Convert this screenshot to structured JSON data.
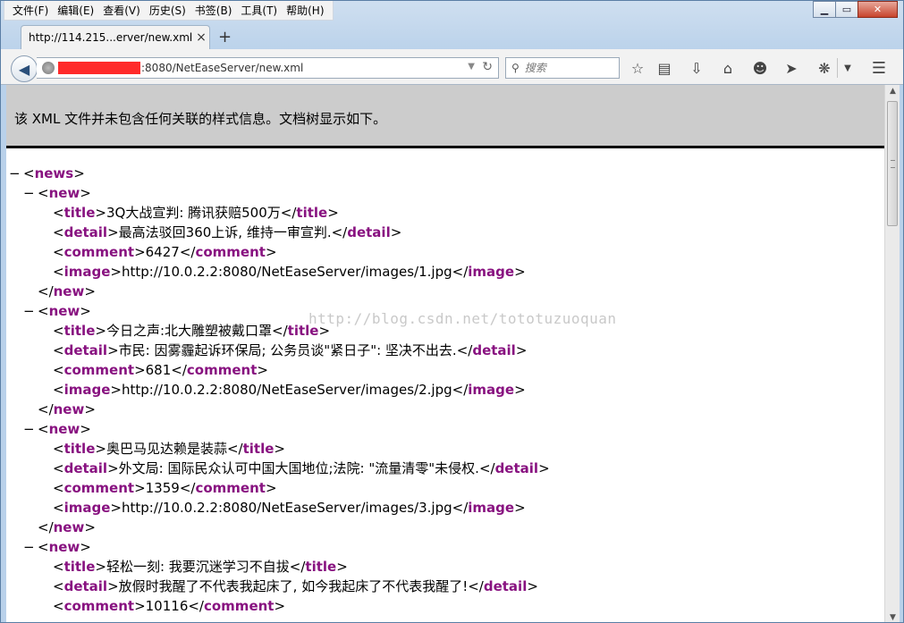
{
  "menu": [
    "文件(F)",
    "编辑(E)",
    "查看(V)",
    "历史(S)",
    "书签(B)",
    "工具(T)",
    "帮助(H)"
  ],
  "window_controls": {
    "minimize": "▁",
    "maximize": "▭",
    "close": "✕"
  },
  "tab": {
    "title": "http://114.215...erver/new.xml",
    "close": "×",
    "new_tab": "+"
  },
  "urlbar": {
    "url_visible": ":8080/NetEaseServer/new.xml",
    "redacted_color": "#ff2a2a"
  },
  "search": {
    "placeholder": "搜索"
  },
  "toolbar_icons": [
    "bookmark-star-icon",
    "reading-list-icon",
    "downloads-icon",
    "home-icon",
    "chat-icon",
    "send-icon",
    "extension-icon",
    "dropdown-icon",
    "menu-icon"
  ],
  "xml_info": "该 XML 文件并未包含任何关联的样式信息。文档树显示如下。",
  "watermark": "http://blog.csdn.net/tototuzuoquan",
  "root_tag": "news",
  "item_tag": "new",
  "items": [
    {
      "title": "3Q大战宣判: 腾讯获赔500万",
      "detail": "最高法驳回360上诉, 维持一审宣判.",
      "comment": "6427",
      "image": "http://10.0.2.2:8080/NetEaseServer/images/1.jpg"
    },
    {
      "title": "今日之声:北大雕塑被戴口罩",
      "detail": "市民: 因雾霾起诉环保局; 公务员谈\"紧日子\": 坚决不出去.",
      "comment": "681",
      "image": "http://10.0.2.2:8080/NetEaseServer/images/2.jpg"
    },
    {
      "title": "奥巴马见达赖是装蒜",
      "detail": "外文局: 国际民众认可中国大国地位;法院: \"流量清零\"未侵权.",
      "comment": "1359",
      "image": "http://10.0.2.2:8080/NetEaseServer/images/3.jpg"
    },
    {
      "title": "轻松一刻: 我要沉迷学习不自拔",
      "detail": "放假时我醒了不代表我起床了, 如今我起床了不代表我醒了!",
      "comment": "10116"
    }
  ],
  "colors": {
    "tag": "#881280",
    "info_bg": "#cccccc"
  }
}
